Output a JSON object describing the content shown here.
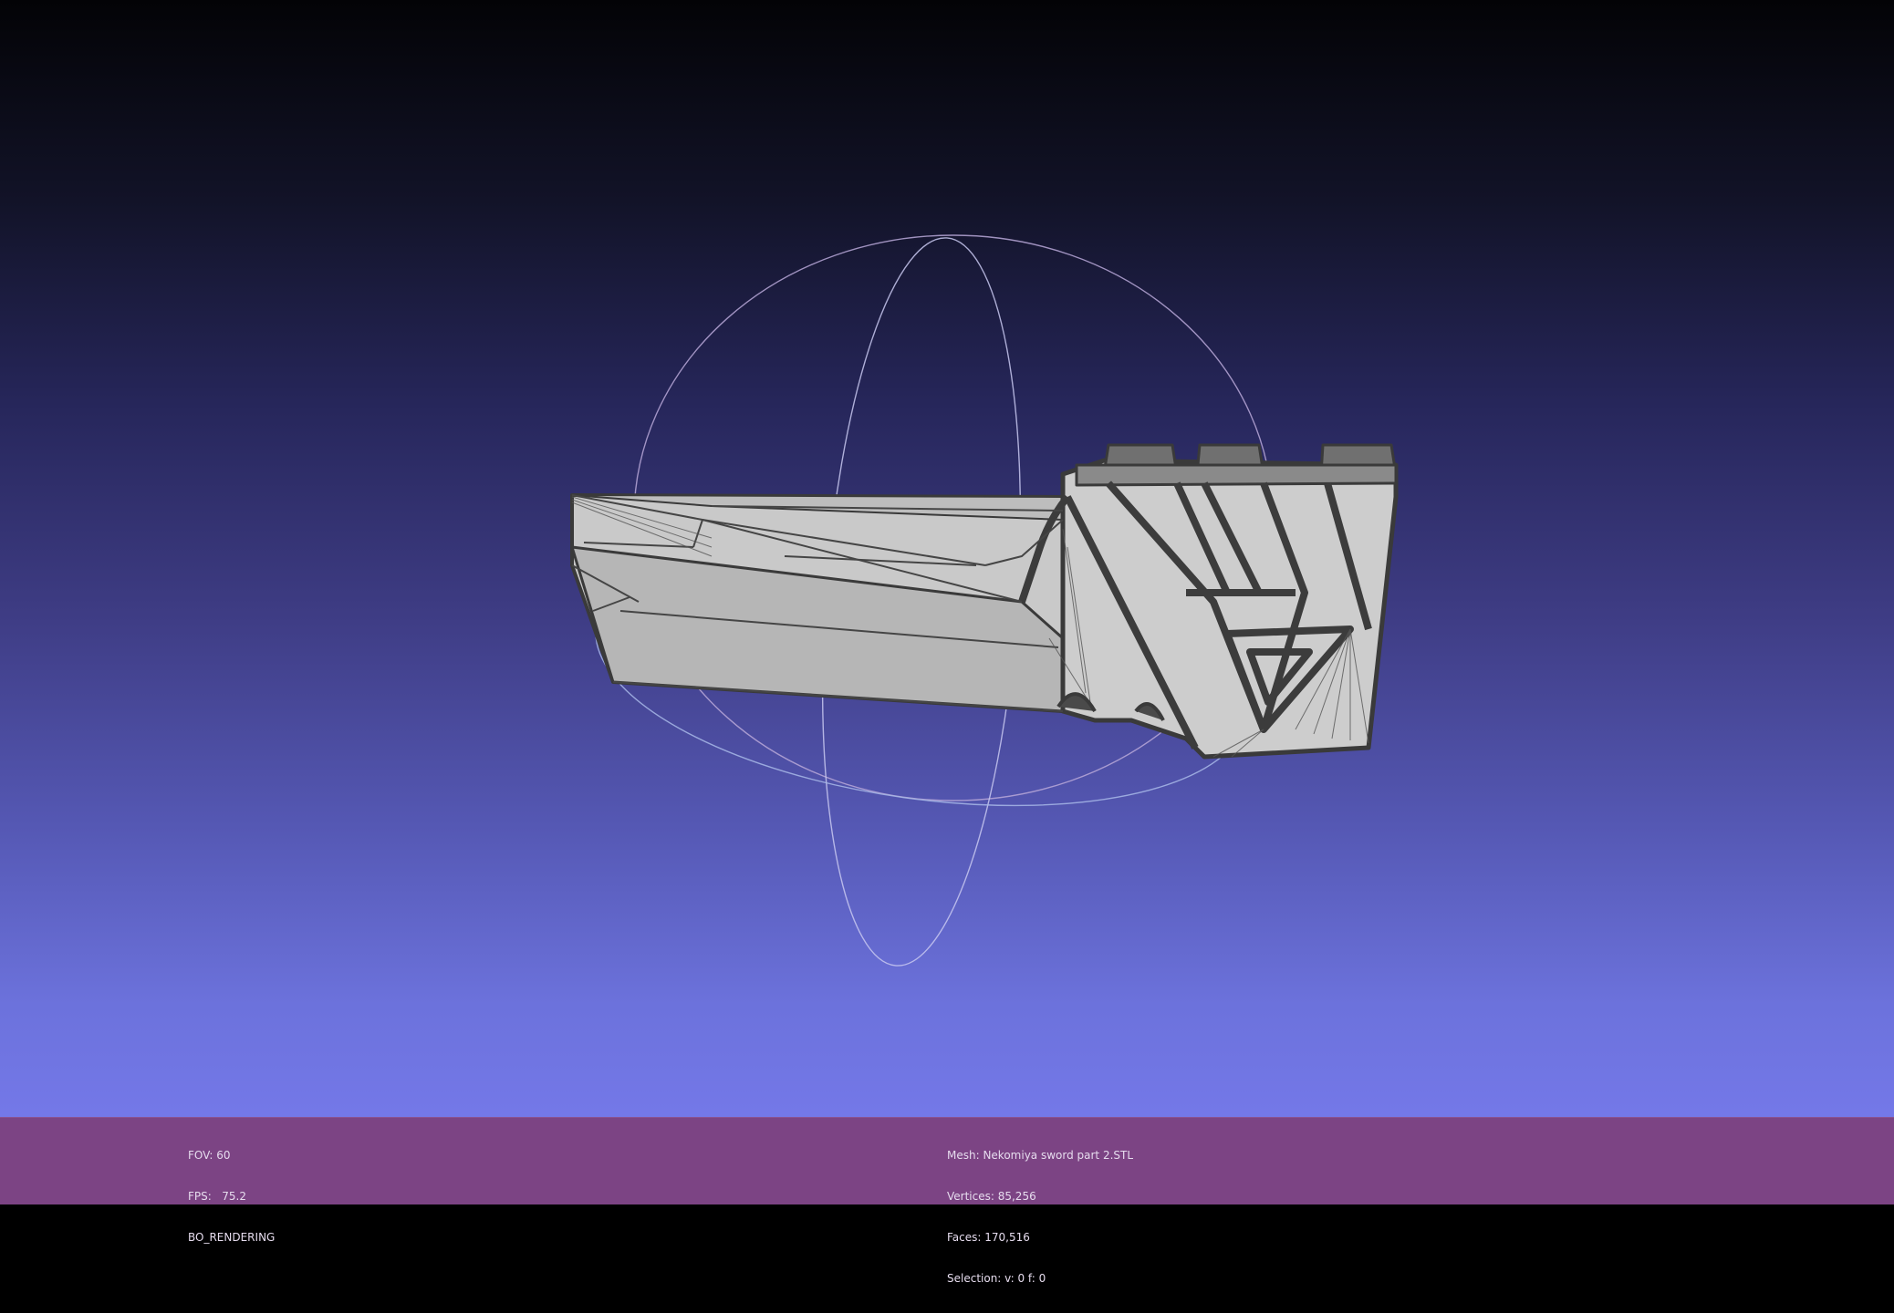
{
  "viewer": {
    "background_gradient": {
      "top": "#030306",
      "bottom": "#7478e8"
    },
    "mesh_fill": "#c8c8c8",
    "wireframe_color": "#3c3c3c",
    "trackball_color": "#c8c8e8"
  },
  "status_left": {
    "fov": "FOV: 60",
    "fps": "FPS:   75.2",
    "render_mode": "BO_RENDERING"
  },
  "status_center": {
    "mesh": "Mesh: Nekomiya sword part 2.STL",
    "vertices": "Vertices: 85,256",
    "faces": "Faces: 170,516",
    "selection": "Selection: v: 0 f: 0"
  },
  "info_bar": {
    "background": "#7c4484",
    "text_color": "#e6dcee"
  }
}
